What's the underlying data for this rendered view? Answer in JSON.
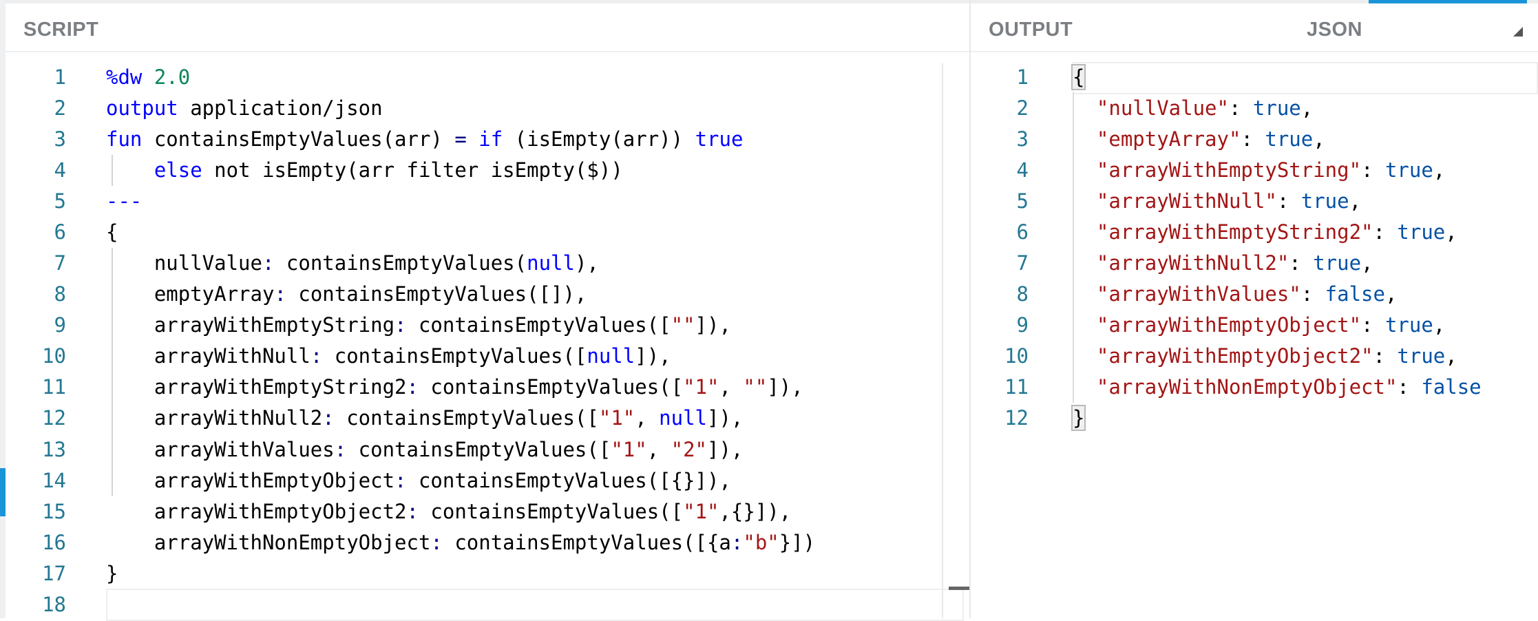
{
  "script_pane": {
    "title": "SCRIPT",
    "lines": [
      {
        "n": "1",
        "tokens": [
          [
            "kw",
            "%dw "
          ],
          [
            "num",
            "2.0"
          ]
        ]
      },
      {
        "n": "2",
        "tokens": [
          [
            "kw",
            "output "
          ],
          [
            "plain",
            "application/json"
          ]
        ]
      },
      {
        "n": "3",
        "tokens": [
          [
            "kw",
            "fun "
          ],
          [
            "plain",
            "containsEmptyValues(arr) "
          ],
          [
            "op",
            "= "
          ],
          [
            "kw",
            "if "
          ],
          [
            "plain",
            "(isEmpty(arr)) "
          ],
          [
            "kw",
            "true"
          ]
        ]
      },
      {
        "n": "4",
        "tokens": [
          [
            "plain",
            "    "
          ],
          [
            "kw",
            "else "
          ],
          [
            "plain",
            "not isEmpty(arr filter isEmpty($))"
          ]
        ]
      },
      {
        "n": "5",
        "tokens": [
          [
            "kw",
            "---"
          ]
        ]
      },
      {
        "n": "6",
        "tokens": [
          [
            "plain",
            "{"
          ]
        ]
      },
      {
        "n": "7",
        "tokens": [
          [
            "plain",
            "    nullValue"
          ],
          [
            "op",
            ": "
          ],
          [
            "plain",
            "containsEmptyValues("
          ],
          [
            "kw",
            "null"
          ],
          [
            "plain",
            "),"
          ]
        ]
      },
      {
        "n": "8",
        "tokens": [
          [
            "plain",
            "    emptyArray"
          ],
          [
            "op",
            ": "
          ],
          [
            "plain",
            "containsEmptyValues([]),"
          ]
        ]
      },
      {
        "n": "9",
        "tokens": [
          [
            "plain",
            "    arrayWithEmptyString"
          ],
          [
            "op",
            ": "
          ],
          [
            "plain",
            "containsEmptyValues(["
          ],
          [
            "str",
            "\"\""
          ],
          [
            "plain",
            "]),"
          ]
        ]
      },
      {
        "n": "10",
        "tokens": [
          [
            "plain",
            "    arrayWithNull"
          ],
          [
            "op",
            ": "
          ],
          [
            "plain",
            "containsEmptyValues(["
          ],
          [
            "kw",
            "null"
          ],
          [
            "plain",
            "]),"
          ]
        ]
      },
      {
        "n": "11",
        "tokens": [
          [
            "plain",
            "    arrayWithEmptyString2"
          ],
          [
            "op",
            ": "
          ],
          [
            "plain",
            "containsEmptyValues(["
          ],
          [
            "str",
            "\"1\""
          ],
          [
            "plain",
            ", "
          ],
          [
            "str",
            "\"\""
          ],
          [
            "plain",
            "]),"
          ]
        ]
      },
      {
        "n": "12",
        "tokens": [
          [
            "plain",
            "    arrayWithNull2"
          ],
          [
            "op",
            ": "
          ],
          [
            "plain",
            "containsEmptyValues(["
          ],
          [
            "str",
            "\"1\""
          ],
          [
            "plain",
            ", "
          ],
          [
            "kw",
            "null"
          ],
          [
            "plain",
            "]),"
          ]
        ]
      },
      {
        "n": "13",
        "tokens": [
          [
            "plain",
            "    arrayWithValues"
          ],
          [
            "op",
            ": "
          ],
          [
            "plain",
            "containsEmptyValues(["
          ],
          [
            "str",
            "\"1\""
          ],
          [
            "plain",
            ", "
          ],
          [
            "str",
            "\"2\""
          ],
          [
            "plain",
            "]),"
          ]
        ]
      },
      {
        "n": "14",
        "tokens": [
          [
            "plain",
            "    arrayWithEmptyObject"
          ],
          [
            "op",
            ": "
          ],
          [
            "plain",
            "containsEmptyValues([{}]),"
          ]
        ]
      },
      {
        "n": "15",
        "tokens": [
          [
            "plain",
            "    arrayWithEmptyObject2"
          ],
          [
            "op",
            ": "
          ],
          [
            "plain",
            "containsEmptyValues(["
          ],
          [
            "str",
            "\"1\""
          ],
          [
            "plain",
            ",{}]),"
          ]
        ]
      },
      {
        "n": "16",
        "tokens": [
          [
            "plain",
            "    arrayWithNonEmptyObject"
          ],
          [
            "op",
            ": "
          ],
          [
            "plain",
            "containsEmptyValues([{a"
          ],
          [
            "op",
            ":"
          ],
          [
            "str",
            "\"b\""
          ],
          [
            "plain",
            "}])"
          ]
        ]
      },
      {
        "n": "17",
        "tokens": [
          [
            "plain",
            "}"
          ]
        ]
      },
      {
        "n": "18",
        "tokens": []
      }
    ]
  },
  "output_pane": {
    "title": "OUTPUT",
    "format": "JSON",
    "lines": [
      {
        "n": "1",
        "tokens": [
          [
            "bracket",
            "{"
          ]
        ]
      },
      {
        "n": "2",
        "tokens": [
          [
            "plain",
            "  "
          ],
          [
            "jkey",
            "\"nullValue\""
          ],
          [
            "plain",
            ": "
          ],
          [
            "jbool",
            "true"
          ],
          [
            "plain",
            ","
          ]
        ]
      },
      {
        "n": "3",
        "tokens": [
          [
            "plain",
            "  "
          ],
          [
            "jkey",
            "\"emptyArray\""
          ],
          [
            "plain",
            ": "
          ],
          [
            "jbool",
            "true"
          ],
          [
            "plain",
            ","
          ]
        ]
      },
      {
        "n": "4",
        "tokens": [
          [
            "plain",
            "  "
          ],
          [
            "jkey",
            "\"arrayWithEmptyString\""
          ],
          [
            "plain",
            ": "
          ],
          [
            "jbool",
            "true"
          ],
          [
            "plain",
            ","
          ]
        ]
      },
      {
        "n": "5",
        "tokens": [
          [
            "plain",
            "  "
          ],
          [
            "jkey",
            "\"arrayWithNull\""
          ],
          [
            "plain",
            ": "
          ],
          [
            "jbool",
            "true"
          ],
          [
            "plain",
            ","
          ]
        ]
      },
      {
        "n": "6",
        "tokens": [
          [
            "plain",
            "  "
          ],
          [
            "jkey",
            "\"arrayWithEmptyString2\""
          ],
          [
            "plain",
            ": "
          ],
          [
            "jbool",
            "true"
          ],
          [
            "plain",
            ","
          ]
        ]
      },
      {
        "n": "7",
        "tokens": [
          [
            "plain",
            "  "
          ],
          [
            "jkey",
            "\"arrayWithNull2\""
          ],
          [
            "plain",
            ": "
          ],
          [
            "jbool",
            "true"
          ],
          [
            "plain",
            ","
          ]
        ]
      },
      {
        "n": "8",
        "tokens": [
          [
            "plain",
            "  "
          ],
          [
            "jkey",
            "\"arrayWithValues\""
          ],
          [
            "plain",
            ": "
          ],
          [
            "jbool",
            "false"
          ],
          [
            "plain",
            ","
          ]
        ]
      },
      {
        "n": "9",
        "tokens": [
          [
            "plain",
            "  "
          ],
          [
            "jkey",
            "\"arrayWithEmptyObject\""
          ],
          [
            "plain",
            ": "
          ],
          [
            "jbool",
            "true"
          ],
          [
            "plain",
            ","
          ]
        ]
      },
      {
        "n": "10",
        "tokens": [
          [
            "plain",
            "  "
          ],
          [
            "jkey",
            "\"arrayWithEmptyObject2\""
          ],
          [
            "plain",
            ": "
          ],
          [
            "jbool",
            "true"
          ],
          [
            "plain",
            ","
          ]
        ]
      },
      {
        "n": "11",
        "tokens": [
          [
            "plain",
            "  "
          ],
          [
            "jkey",
            "\"arrayWithNonEmptyObject\""
          ],
          [
            "plain",
            ": "
          ],
          [
            "jbool",
            "false"
          ]
        ]
      },
      {
        "n": "12",
        "tokens": [
          [
            "bracket",
            "}"
          ]
        ]
      }
    ]
  }
}
